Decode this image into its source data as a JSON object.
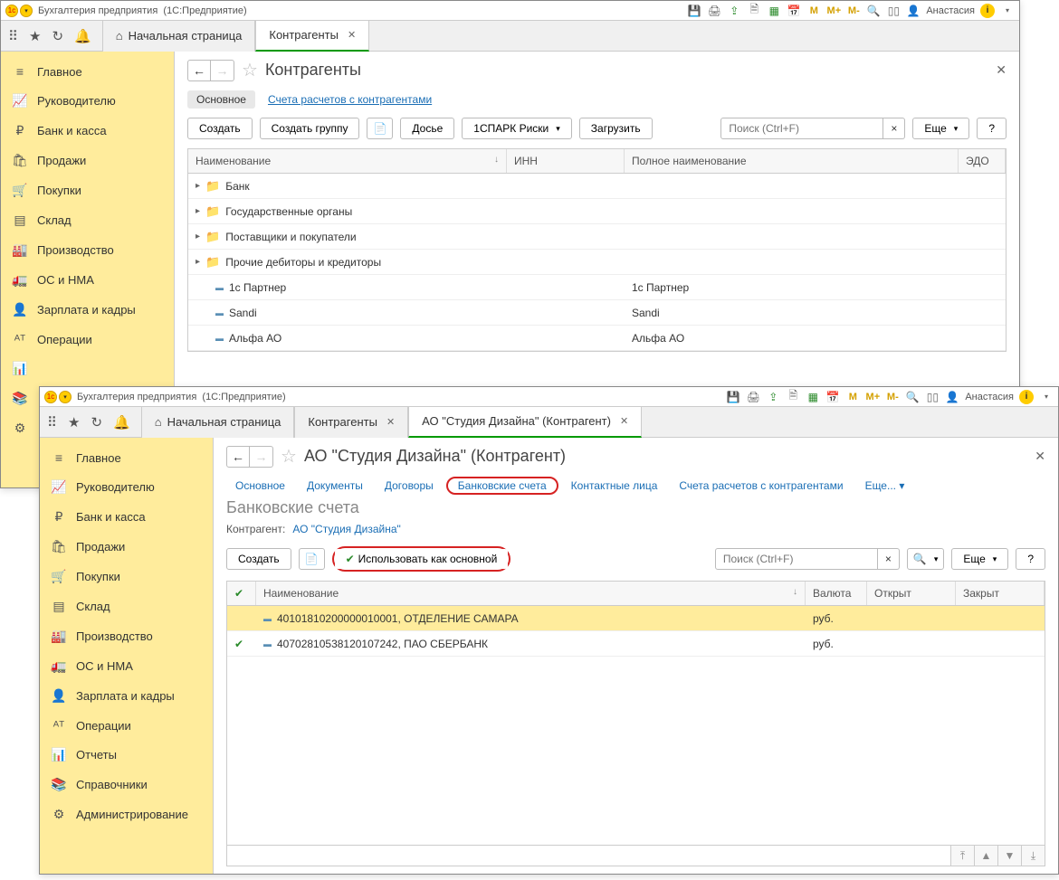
{
  "titlebar": {
    "app_name": "Бухгалтерия предприятия",
    "app_platform": "(1С:Предприятие)",
    "mem_m": "M",
    "mem_mplus": "M+",
    "mem_mminus": "M-",
    "user_name": "Анастасия",
    "info": "i"
  },
  "tabbar": {
    "home_tab": "Начальная страница"
  },
  "sidebar": [
    {
      "icon": "≡",
      "label": "Главное"
    },
    {
      "icon": "📈",
      "label": "Руководителю"
    },
    {
      "icon": "₽",
      "label": "Банк и касса"
    },
    {
      "icon": "🛍",
      "label": "Продажи"
    },
    {
      "icon": "🛒",
      "label": "Покупки"
    },
    {
      "icon": "▤",
      "label": "Склад"
    },
    {
      "icon": "🏭",
      "label": "Производство"
    },
    {
      "icon": "🚛",
      "label": "ОС и НМА"
    },
    {
      "icon": "👤",
      "label": "Зарплата и кадры"
    },
    {
      "icon": "ᴬᵀ",
      "label": "Операции"
    },
    {
      "icon": "📊",
      "label": "Отчеты"
    },
    {
      "icon": "📚",
      "label": "Справочники"
    },
    {
      "icon": "⚙",
      "label": "Администрирование"
    }
  ],
  "w1": {
    "tab_label": "Контрагенты",
    "page_title": "Контрагенты",
    "subnav": {
      "main": "Основное",
      "accounts": "Счета расчетов с контрагентами"
    },
    "toolbar": {
      "create": "Создать",
      "create_group": "Создать группу",
      "dossier": "Досье",
      "spark": "1СПАРК Риски",
      "load": "Загрузить",
      "search_placeholder": "Поиск (Ctrl+F)",
      "more": "Еще",
      "help": "?"
    },
    "table": {
      "cols": {
        "name": "Наименование",
        "inn": "ИНН",
        "fullname": "Полное наименование",
        "edo": "ЭДО"
      },
      "folders": [
        {
          "name": "Банк"
        },
        {
          "name": "Государственные органы"
        },
        {
          "name": "Поставщики и покупатели"
        },
        {
          "name": "Прочие дебиторы и кредиторы"
        }
      ],
      "items": [
        {
          "name": "1с Партнер",
          "fullname": "1с Партнер"
        },
        {
          "name": "Sandi",
          "fullname": "Sandi"
        },
        {
          "name": "Альфа АО",
          "fullname": "Альфа АО"
        }
      ]
    }
  },
  "w2": {
    "tab_contragents": "Контрагенты",
    "tab_label": "АО \"Студия Дизайна\" (Контрагент)",
    "page_title": "АО \"Студия Дизайна\" (Контрагент)",
    "subnav": {
      "main": "Основное",
      "docs": "Документы",
      "contracts": "Договоры",
      "bankacc": "Банковские счета",
      "contacts": "Контактные лица",
      "accounts": "Счета расчетов с контрагентами",
      "more": "Еще..."
    },
    "section_title": "Банковские счета",
    "kv": {
      "label": "Контрагент:",
      "value": "АО \"Студия Дизайна\""
    },
    "toolbar": {
      "create": "Создать",
      "use_as_main": "Использовать как основной",
      "search_placeholder": "Поиск (Ctrl+F)",
      "more": "Еще",
      "help": "?"
    },
    "table": {
      "cols": {
        "name": "Наименование",
        "currency": "Валюта",
        "opened": "Открыт",
        "closed": "Закрыт"
      },
      "rows": [
        {
          "checked": false,
          "name": "40101810200000010001, ОТДЕЛЕНИЕ САМАРА",
          "currency": "руб.",
          "highlighted": true
        },
        {
          "checked": true,
          "name": "40702810538120107242, ПАО СБЕРБАНК",
          "currency": "руб.",
          "highlighted": false
        }
      ]
    }
  }
}
